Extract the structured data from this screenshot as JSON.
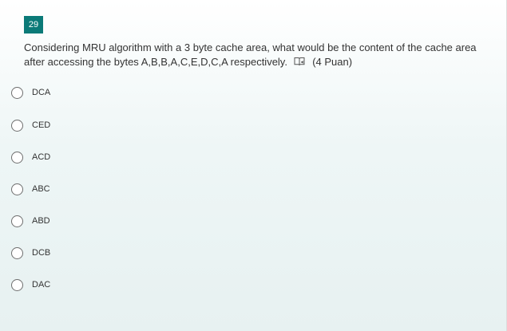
{
  "question": {
    "number": "29",
    "text": "Considering MRU algorithm with a 3 byte cache area, what would be the content of the cache area after accessing the bytes A,B,B,A,C,E,D,C,A respectively.",
    "points": "(4 Puan)",
    "immersive_reader_icon": "immersive-reader-icon"
  },
  "options": [
    {
      "label": "DCA"
    },
    {
      "label": "CED"
    },
    {
      "label": "ACD"
    },
    {
      "label": "ABC"
    },
    {
      "label": "ABD"
    },
    {
      "label": "DCB"
    },
    {
      "label": "DAC"
    }
  ],
  "colors": {
    "accent": "#0b7a78",
    "text": "#333333",
    "radio_border": "#6e6e6e"
  }
}
